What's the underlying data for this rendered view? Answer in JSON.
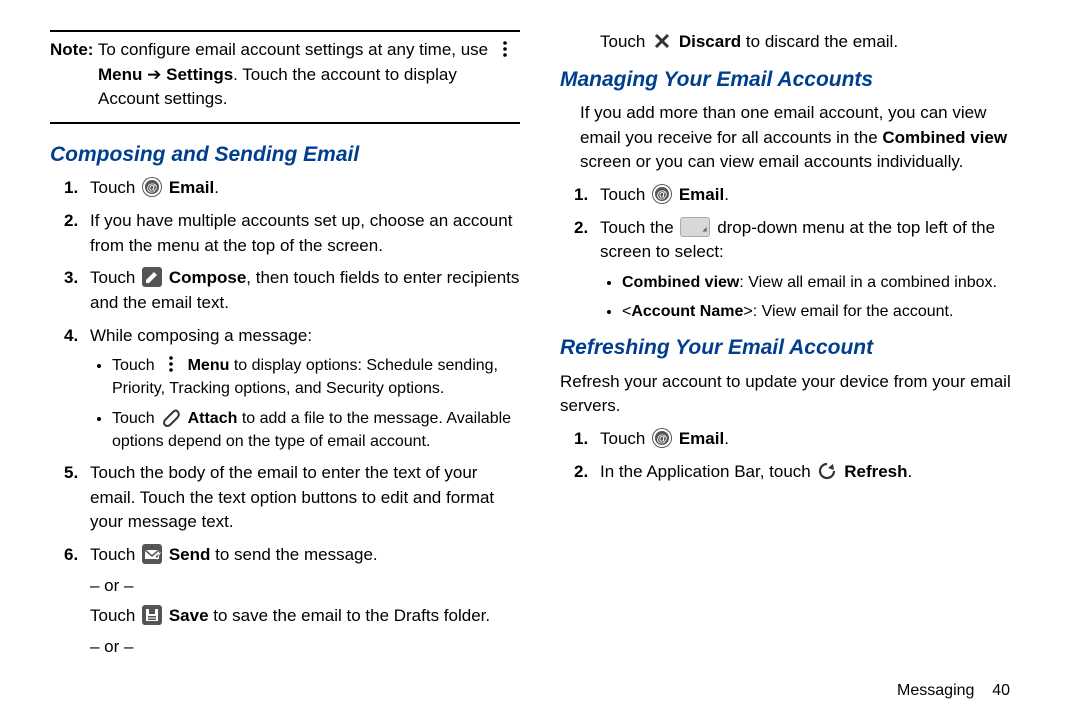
{
  "note": {
    "label": "Note:",
    "text_a": "To configure email account settings at any time, use",
    "menu": "Menu",
    "arrow": "➔",
    "settings": "Settings",
    "text_b": ". Touch the account to display Account settings."
  },
  "composing": {
    "heading": "Composing and Sending Email",
    "step1": {
      "num": "1.",
      "a": "Touch ",
      "b": " ",
      "boldEmail": "Email",
      "c": "."
    },
    "step2": {
      "num": "2.",
      "text": "If you have multiple accounts set up, choose an account from the menu at the top of the screen."
    },
    "step3": {
      "num": "3.",
      "a": "Touch ",
      "boldCompose": "Compose",
      "b": ", then touch fields to enter recipients and the email text."
    },
    "step4": {
      "num": "4.",
      "lead": "While composing a message:",
      "b1a": "Touch ",
      "b1menu": "Menu",
      "b1b": " to display options: Schedule sending, Priority, Tracking options, and Security options.",
      "b2a": "Touch ",
      "b2attach": "Attach",
      "b2b": " to add a file to the message. Available options depend on the type of email account."
    },
    "step5": {
      "num": "5.",
      "text": "Touch the body of the email to enter the text of your email. Touch the text option buttons to edit and format your message text."
    },
    "step6": {
      "num": "6.",
      "a": "Touch ",
      "send": "Send",
      "b": " to send the message.",
      "or": "– or –",
      "c": "Touch ",
      "save": "Save",
      "d": " to save the email to the Drafts folder.",
      "e": "Touch ",
      "discard": "Discard",
      "f": " to discard the email."
    }
  },
  "managing": {
    "heading": "Managing Your Email Accounts",
    "intro_a": "If you add more than one email account, you can view email you receive for all accounts in the ",
    "intro_bold": "Combined view",
    "intro_b": " screen or you can view email accounts individually.",
    "step1": {
      "num": "1.",
      "a": "Touch ",
      "email": "Email",
      "c": "."
    },
    "step2": {
      "num": "2.",
      "a": "Touch the ",
      "b": " drop-down menu at the top left of the screen to select:",
      "b1bold": "Combined view",
      "b1text": ": View all email in a combined inbox.",
      "b2bold": "Account Name",
      "b2text": ": View email for the account."
    }
  },
  "refreshing": {
    "heading": "Refreshing Your Email Account",
    "intro": "Refresh your account to update your device from your email servers.",
    "step1": {
      "num": "1.",
      "a": "Touch ",
      "email": "Email",
      "c": "."
    },
    "step2": {
      "num": "2.",
      "a": "In the Application Bar, touch ",
      "refresh": "Refresh",
      "c": "."
    }
  },
  "footer": {
    "section": "Messaging",
    "page": "40"
  }
}
